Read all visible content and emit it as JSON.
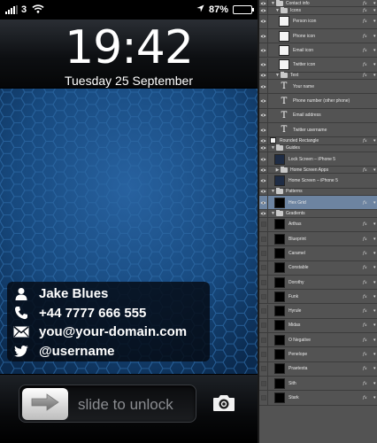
{
  "status_bar": {
    "carrier": "3",
    "battery": "87%",
    "battery_level": 0.87
  },
  "lock": {
    "time": "19:42",
    "date": "Tuesday 25 September",
    "slider_text": "slide to unlock"
  },
  "contact": {
    "name": "Jake Blues",
    "phone": "+44 7777 666 555",
    "email": "you@your-domain.com",
    "twitter": "@username"
  },
  "layers": [
    {
      "name": "Contact info",
      "kind": "group",
      "visible": true,
      "expanded": true,
      "indent": 0,
      "fx": true
    },
    {
      "name": "Icons",
      "kind": "group",
      "visible": true,
      "expanded": true,
      "indent": 1,
      "fx": true
    },
    {
      "name": "Person icon",
      "kind": "white-thumb",
      "visible": true,
      "indent": 2,
      "fx": true,
      "big": true
    },
    {
      "name": "Phone icon",
      "kind": "white-thumb",
      "visible": true,
      "indent": 2,
      "fx": true,
      "big": true
    },
    {
      "name": "Email icon",
      "kind": "white-thumb",
      "visible": true,
      "indent": 2,
      "fx": true,
      "big": true
    },
    {
      "name": "Twitter icon",
      "kind": "white-thumb",
      "visible": true,
      "indent": 2,
      "fx": true,
      "big": true
    },
    {
      "name": "Text",
      "kind": "group",
      "visible": true,
      "expanded": true,
      "indent": 1,
      "fx": true
    },
    {
      "name": "Your name",
      "kind": "text",
      "visible": true,
      "indent": 2,
      "fx": false,
      "big": true
    },
    {
      "name": "Phone number (other phone)",
      "kind": "text",
      "visible": true,
      "indent": 2,
      "fx": false,
      "big": true
    },
    {
      "name": "Email address",
      "kind": "text",
      "visible": true,
      "indent": 2,
      "fx": false,
      "big": true
    },
    {
      "name": "Twitter username",
      "kind": "text",
      "visible": true,
      "indent": 2,
      "fx": false,
      "big": true
    },
    {
      "name": "Rounded Rectangle",
      "kind": "white-thumb",
      "visible": true,
      "indent": 0,
      "fx": true
    },
    {
      "name": "Guides",
      "kind": "group",
      "visible": true,
      "expanded": true,
      "indent": 0,
      "fx": false
    },
    {
      "name": "Lock Screen – iPhone 5",
      "kind": "blue-thumb",
      "visible": true,
      "indent": 1,
      "fx": false,
      "big": true
    },
    {
      "name": "Home Screen Apps",
      "kind": "group",
      "visible": true,
      "expanded": false,
      "indent": 1,
      "fx": true
    },
    {
      "name": "Home Screen – iPhone 5",
      "kind": "blue-thumb",
      "visible": true,
      "indent": 1,
      "fx": false,
      "big": true
    },
    {
      "name": "Patterns",
      "kind": "group",
      "visible": true,
      "expanded": true,
      "indent": 0,
      "fx": false
    },
    {
      "name": "Hex Grid",
      "kind": "black-thumb",
      "visible": true,
      "indent": 1,
      "fx": true,
      "big": true,
      "selected": true
    },
    {
      "name": "Gradients",
      "kind": "group",
      "visible": true,
      "expanded": true,
      "indent": 0,
      "fx": false
    },
    {
      "name": "Arthas",
      "kind": "black-thumb",
      "visible": false,
      "indent": 1,
      "fx": true,
      "big": true
    },
    {
      "name": "Blueprint",
      "kind": "black-thumb",
      "visible": false,
      "indent": 1,
      "fx": true,
      "big": true
    },
    {
      "name": "Caramel",
      "kind": "black-thumb",
      "visible": false,
      "indent": 1,
      "fx": true,
      "big": true
    },
    {
      "name": "Constable",
      "kind": "black-thumb",
      "visible": false,
      "indent": 1,
      "fx": true,
      "big": true
    },
    {
      "name": "Dorothy",
      "kind": "black-thumb",
      "visible": false,
      "indent": 1,
      "fx": true,
      "big": true
    },
    {
      "name": "Funk",
      "kind": "black-thumb",
      "visible": false,
      "indent": 1,
      "fx": true,
      "big": true
    },
    {
      "name": "Hyrule",
      "kind": "black-thumb",
      "visible": false,
      "indent": 1,
      "fx": true,
      "big": true
    },
    {
      "name": "Midas",
      "kind": "black-thumb",
      "visible": false,
      "indent": 1,
      "fx": true,
      "big": true
    },
    {
      "name": "O Negative",
      "kind": "black-thumb",
      "visible": false,
      "indent": 1,
      "fx": true,
      "big": true
    },
    {
      "name": "Penelope",
      "kind": "black-thumb",
      "visible": false,
      "indent": 1,
      "fx": true,
      "big": true
    },
    {
      "name": "Praetexta",
      "kind": "black-thumb",
      "visible": false,
      "indent": 1,
      "fx": true,
      "big": true
    },
    {
      "name": "Sith",
      "kind": "black-thumb",
      "visible": false,
      "indent": 1,
      "fx": true,
      "big": true
    },
    {
      "name": "Stark",
      "kind": "black-thumb",
      "visible": false,
      "indent": 1,
      "fx": true,
      "big": true
    }
  ],
  "colors": {
    "wallpaper": "#1b4f86",
    "hex_line": "#2d6aa6",
    "panel": "#535353",
    "selected_layer": "#6d84a1"
  },
  "icons": {
    "wifi": "wifi-icon",
    "location": "location-arrow-icon",
    "person": "person-icon",
    "phone": "phone-icon",
    "email": "envelope-icon",
    "twitter": "twitter-bird-icon",
    "slider": "arrow-right-icon",
    "camera": "camera-icon",
    "eye": "eye-icon",
    "folder": "folder-icon"
  }
}
